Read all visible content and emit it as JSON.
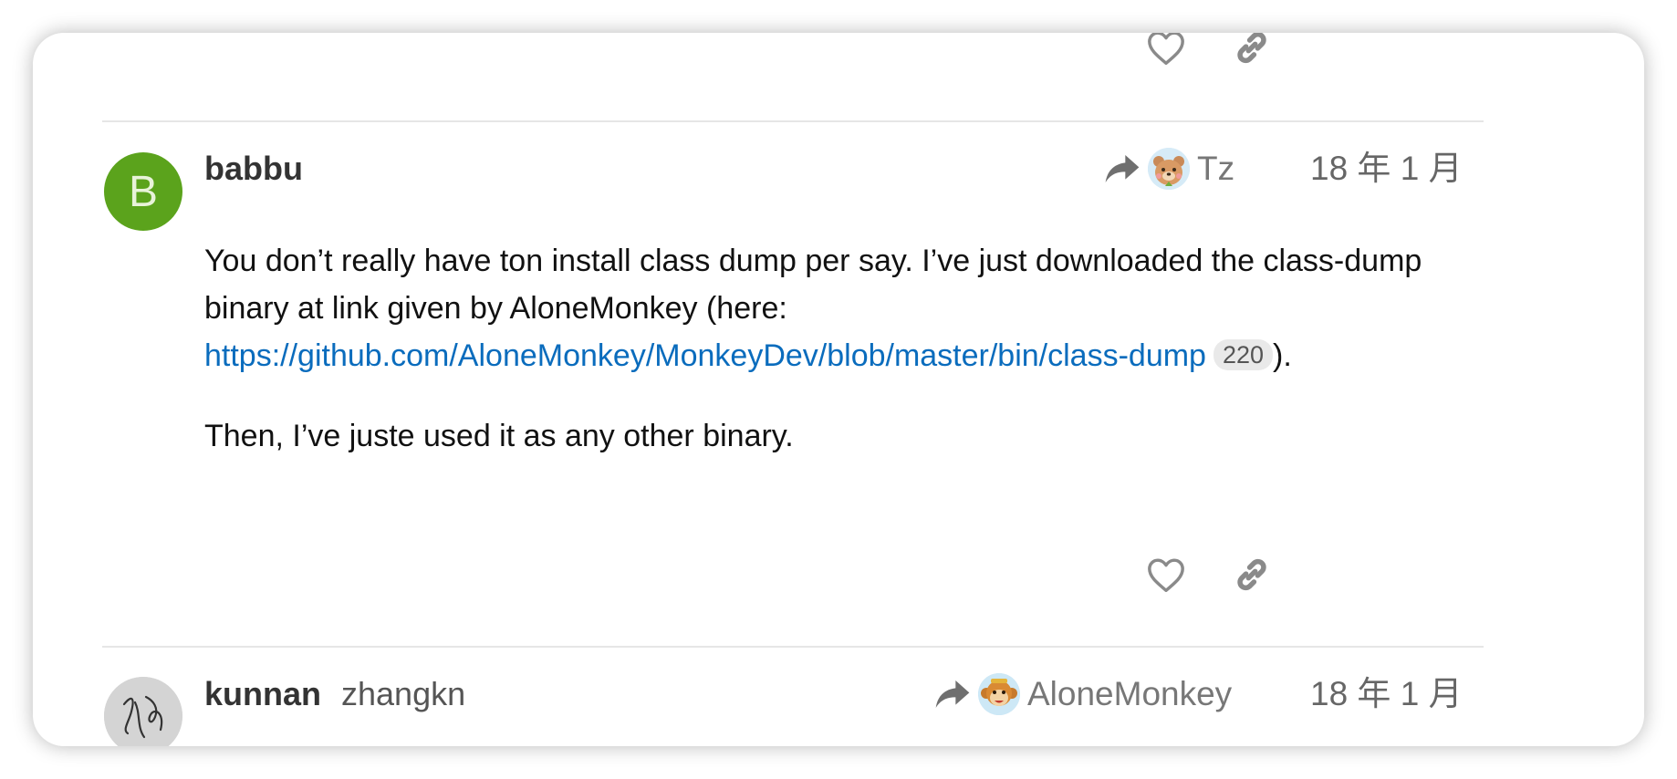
{
  "topbar": {
    "like_icon": "heart-outline-icon",
    "link_icon": "link-icon"
  },
  "post1": {
    "avatar_letter": "B",
    "avatar_color": "#5ba31c",
    "username": "babbu",
    "reply_to": {
      "icon": "reply-arrow-icon",
      "avatar": "bear-avatar",
      "name": "Tz"
    },
    "date": "18 年 1 月",
    "body": {
      "para1_text": "You don’t really have ton install class dump per say. I’ve just downloaded the class-dump binary at link given by AloneMonkey (here: ",
      "link_text": "https://github.com/AloneMonkey/MonkeyDev/blob/master/bin/class-dump",
      "link_clicks": "220",
      "para1_end": ").",
      "para2_text": "Then, I’ve juste used it as any other binary."
    },
    "actions": {
      "like_icon": "heart-outline-icon",
      "link_icon": "link-icon"
    }
  },
  "post2": {
    "avatar": "signature-avatar",
    "username": "kunnan",
    "full_name": "zhangkn",
    "reply_to": {
      "icon": "reply-arrow-icon",
      "avatar": "monkey-avatar",
      "name": "AloneMonkey"
    },
    "date": "18 年 1 月"
  },
  "colors": {
    "link": "#0a6cbd",
    "icon_gray": "#8a8a8a",
    "accent_green": "#5ba31c"
  }
}
